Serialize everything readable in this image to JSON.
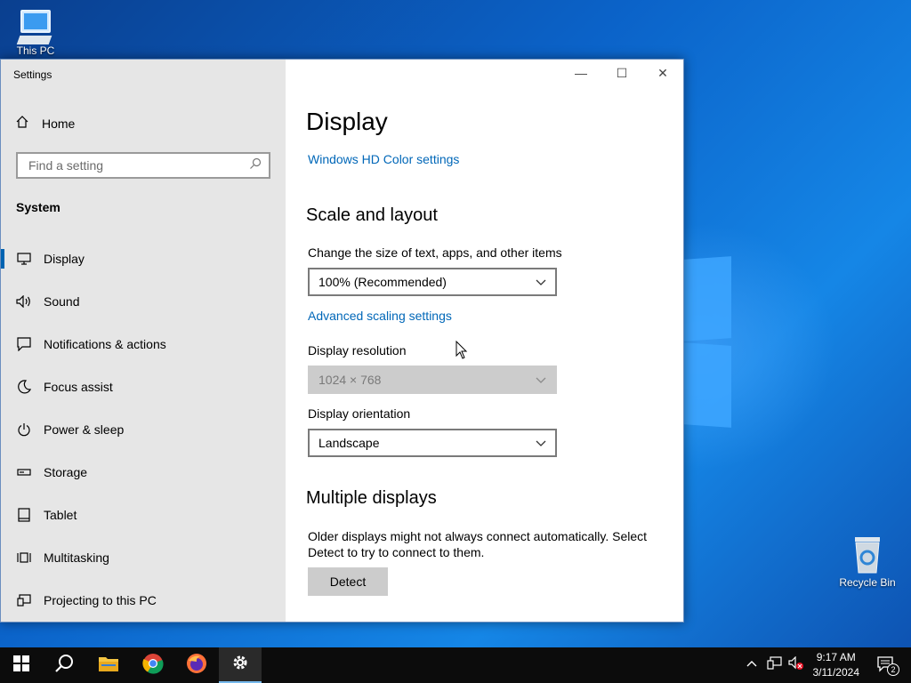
{
  "desktop": {
    "icons": [
      {
        "label": "This PC"
      },
      {
        "label": "Recycle Bin"
      }
    ]
  },
  "window": {
    "title": "Settings",
    "controls": {
      "minimize": "—",
      "maximize": "☐",
      "close": "✕"
    }
  },
  "sidebar": {
    "home_label": "Home",
    "search_placeholder": "Find a setting",
    "section_title": "System",
    "items": [
      {
        "label": "Display",
        "icon": "monitor-icon",
        "active": true
      },
      {
        "label": "Sound",
        "icon": "speaker-icon"
      },
      {
        "label": "Notifications & actions",
        "icon": "notification-icon"
      },
      {
        "label": "Focus assist",
        "icon": "moon-icon"
      },
      {
        "label": "Power & sleep",
        "icon": "power-icon"
      },
      {
        "label": "Storage",
        "icon": "storage-icon"
      },
      {
        "label": "Tablet",
        "icon": "tablet-icon"
      },
      {
        "label": "Multitasking",
        "icon": "multitasking-icon"
      },
      {
        "label": "Projecting to this PC",
        "icon": "projecting-icon"
      }
    ]
  },
  "main": {
    "title": "Display",
    "hd_color_link": "Windows HD Color settings",
    "scale_section": "Scale and layout",
    "scale_label": "Change the size of text, apps, and other items",
    "scale_value": "100% (Recommended)",
    "advanced_link": "Advanced scaling settings",
    "resolution_label": "Display resolution",
    "resolution_value": "1024 × 768",
    "orientation_label": "Display orientation",
    "orientation_value": "Landscape",
    "multiple_section": "Multiple displays",
    "multiple_desc_1": "Older displays might not always connect automatically. Select",
    "multiple_desc_2": "Detect to try to connect to them.",
    "detect_button": "Detect"
  },
  "taskbar": {
    "time": "9:17 AM",
    "date": "3/11/2024",
    "notification_count": "2"
  },
  "colors": {
    "accent": "#0063b1",
    "link": "#0067b8",
    "sidebar_bg": "#e6e6e6",
    "taskbar_bg": "#0c0c0c"
  }
}
